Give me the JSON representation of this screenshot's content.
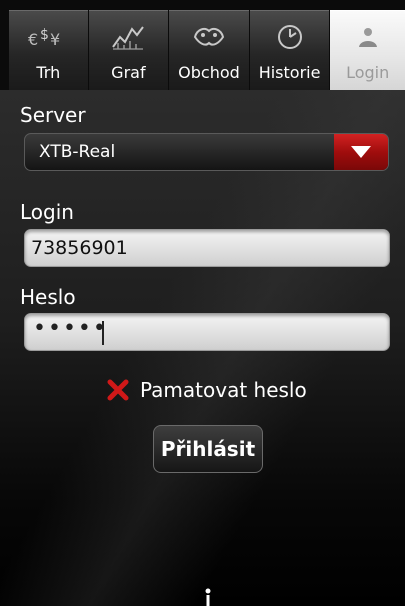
{
  "tabs": [
    {
      "label": "Trh",
      "icon": "currency-exchange-icon"
    },
    {
      "label": "Graf",
      "icon": "chart-icon"
    },
    {
      "label": "Obchod",
      "icon": "trade-icon"
    },
    {
      "label": "Historie",
      "icon": "clock-icon"
    },
    {
      "label": "Login",
      "icon": "user-icon",
      "active": true
    }
  ],
  "form": {
    "server_label": "Server",
    "server_value": "XTB-Real",
    "login_label": "Login",
    "login_value": "73856901",
    "password_label": "Heslo",
    "password_value": "•••••",
    "remember_label": "Pamatovat heslo",
    "remember_checked": false,
    "submit_label": "Přihlásit"
  },
  "colors": {
    "accent": "#c11a1a",
    "background": "#1e1e1e",
    "active_tab": "#eeeeee"
  }
}
